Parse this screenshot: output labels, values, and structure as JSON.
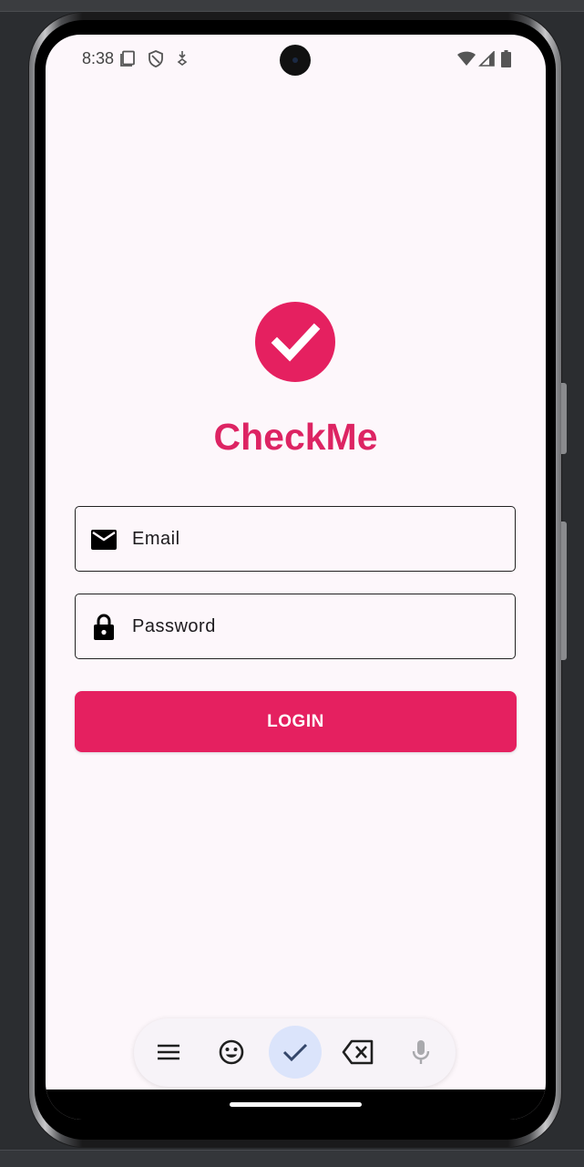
{
  "status_bar": {
    "time": "8:38",
    "icons": [
      "sim-card-icon",
      "shield-icon",
      "location-download-icon",
      "wifi-icon",
      "signal-icon",
      "battery-icon"
    ]
  },
  "app": {
    "logo_icon": "check-circle-icon",
    "title": "CheckMe",
    "accent_color": "#e52060"
  },
  "form": {
    "email": {
      "icon": "mail-icon",
      "placeholder": "Email",
      "value": ""
    },
    "password": {
      "icon": "lock-icon",
      "placeholder": "Password",
      "value": ""
    },
    "login_label": "LOGIN"
  },
  "keyboard_toolbar": {
    "items": [
      "menu-icon",
      "emoji-icon",
      "check-icon",
      "backspace-icon",
      "microphone-icon"
    ],
    "active_item": "check-icon"
  }
}
